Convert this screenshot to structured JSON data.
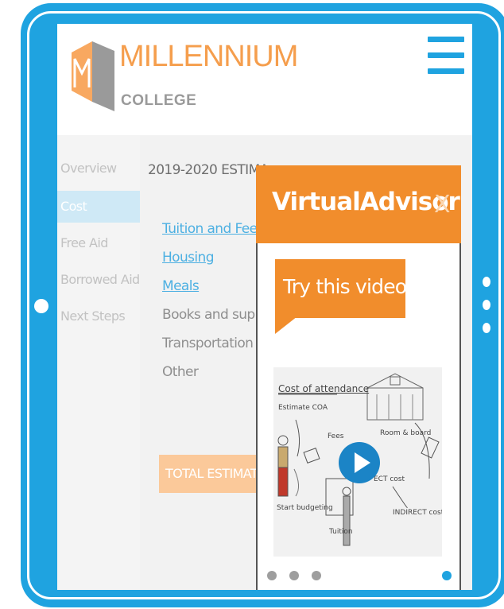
{
  "brand": {
    "name": "MILLENNIUM",
    "sub": "COLLEGE"
  },
  "nav": {
    "items": [
      {
        "label": "Overview",
        "active": false
      },
      {
        "label": "Cost",
        "active": true
      },
      {
        "label": "Free Aid",
        "active": false
      },
      {
        "label": "Borrowed Aid",
        "active": false
      },
      {
        "label": "Next Steps",
        "active": false
      }
    ]
  },
  "content": {
    "title": "2019-2020 ESTIMA",
    "items": [
      {
        "label": "Tuition and Fees",
        "link": true
      },
      {
        "label": "Housing",
        "link": true
      },
      {
        "label": "Meals",
        "link": true
      },
      {
        "label": "Books and supplie",
        "link": false
      },
      {
        "label": "Transportation",
        "link": false
      },
      {
        "label": "Other",
        "link": false
      }
    ],
    "total_label": "TOTAL ESTIMATED"
  },
  "advisor": {
    "title": "VirtualAdvisor",
    "close": "X",
    "prompt": "Try this video:",
    "video_labels": {
      "heading": "Cost of attendance",
      "estimate": "Estimate COA",
      "fees": "Fees",
      "room": "Room & board",
      "direct": "ECT cost",
      "indirect": "INDIRECT cost",
      "budget": "Start budgeting",
      "tuition": "Tuition"
    },
    "carousel": {
      "count": 4,
      "active_index": 3
    }
  },
  "colors": {
    "frame": "#1fa3e0",
    "accent": "#f18d2c",
    "link": "#4db0e2"
  }
}
